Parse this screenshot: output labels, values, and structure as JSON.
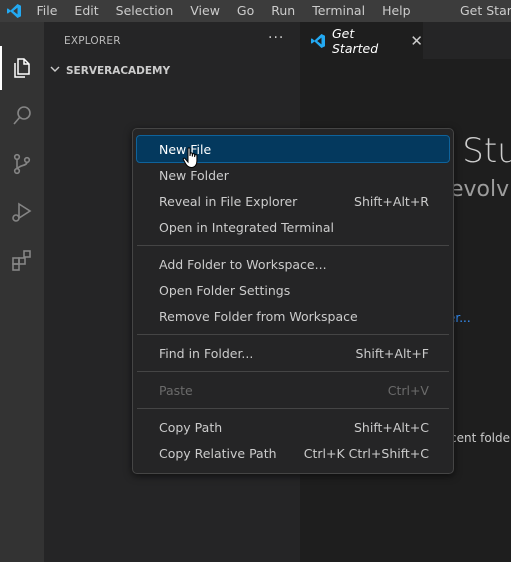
{
  "titlebar": {
    "menus": [
      "File",
      "Edit",
      "Selection",
      "View",
      "Go",
      "Run",
      "Terminal",
      "Help"
    ],
    "window_title": "Get Starte"
  },
  "activity_bar": {
    "icons": [
      "explorer-icon",
      "search-icon",
      "source-control-icon",
      "run-debug-icon",
      "extensions-icon"
    ]
  },
  "sidebar": {
    "title": "EXPLORER",
    "more": "···",
    "folder": "SERVERACADEMY"
  },
  "tab": {
    "label": "Get Started",
    "close": "✕"
  },
  "editor": {
    "title": "l Stu",
    "subtitle": "evolv",
    "link1": ".",
    "link2": "er...",
    "recent": "cent folde"
  },
  "context_menu": {
    "selected_item": "New File",
    "groups": [
      [
        {
          "label": "New File",
          "shortcut": ""
        },
        {
          "label": "New Folder",
          "shortcut": ""
        },
        {
          "label": "Reveal in File Explorer",
          "shortcut": "Shift+Alt+R"
        },
        {
          "label": "Open in Integrated Terminal",
          "shortcut": ""
        }
      ],
      [
        {
          "label": "Add Folder to Workspace...",
          "shortcut": ""
        },
        {
          "label": "Open Folder Settings",
          "shortcut": ""
        },
        {
          "label": "Remove Folder from Workspace",
          "shortcut": ""
        }
      ],
      [
        {
          "label": "Find in Folder...",
          "shortcut": "Shift+Alt+F"
        }
      ],
      [
        {
          "label": "Paste",
          "shortcut": "Ctrl+V",
          "disabled": true
        }
      ],
      [
        {
          "label": "Copy Path",
          "shortcut": "Shift+Alt+C"
        },
        {
          "label": "Copy Relative Path",
          "shortcut": "Ctrl+K Ctrl+Shift+C"
        }
      ]
    ]
  },
  "colors": {
    "accent": "#007acc",
    "selection": "#04395e",
    "link": "#3794ff"
  }
}
